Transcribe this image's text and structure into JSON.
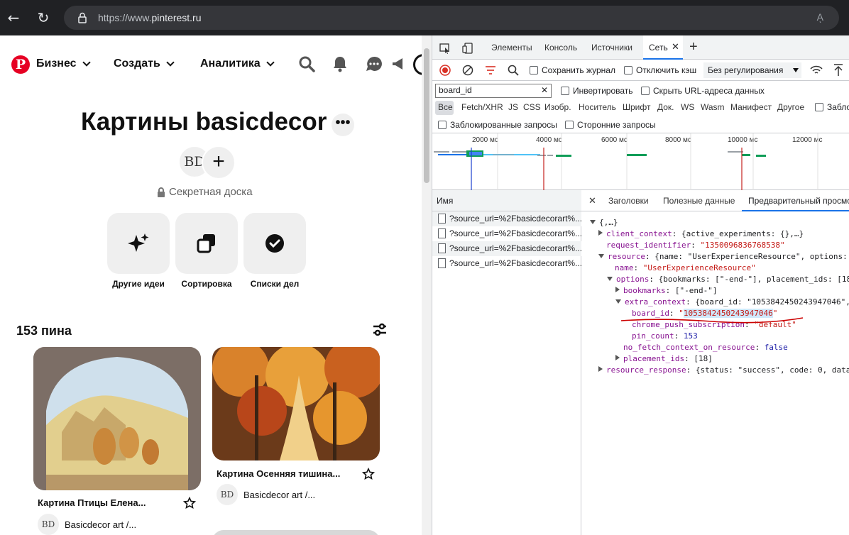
{
  "browser": {
    "url_prefix": "https://www.",
    "url_domain": "pinterest.ru",
    "read_aloud": "Aͅ"
  },
  "pinterest": {
    "logo_letter": "P",
    "nav": {
      "business": "Бизнес",
      "create": "Создать",
      "analytics": "Аналитика"
    },
    "board_title": "Картины basicdecor",
    "more_label": "•••",
    "avatar_text": "BD",
    "secret": "Секретная доска",
    "tiles": [
      {
        "label": "Другие идеи",
        "icon": "sparkle-icon"
      },
      {
        "label": "Сортировка",
        "icon": "organize-icon"
      },
      {
        "label": "Списки дел",
        "icon": "checklist-icon"
      }
    ],
    "pin_count": "153 пина",
    "pins": [
      {
        "title": "Картина Птицы Елена...",
        "author": "Basicdecor art /..."
      },
      {
        "title": "Картина Осенняя тишина...",
        "author": "Basicdecor art /..."
      }
    ]
  },
  "devtools": {
    "tabs": [
      "Элементы",
      "Консоль",
      "Источники",
      "Сеть"
    ],
    "toolbar": {
      "preserve_log": "Сохранить журнал",
      "disable_cache": "Отключить кэш",
      "throttling": "Без регулирования"
    },
    "filter_value": "board_id",
    "invert": "Инвертировать",
    "hide_data_urls": "Скрыть URL-адреса данных",
    "types": [
      "Все",
      "Fetch/XHR",
      "JS",
      "CSS",
      "Изобр.",
      "Носитель",
      "Шрифт",
      "Док.",
      "WS",
      "Wasm",
      "Манифест",
      "Другое"
    ],
    "blocked_cookies": "Заблок",
    "blocked_requests": "Заблокированные запросы",
    "third_party": "Сторонние запросы",
    "timeline_ticks": [
      "2000 мс",
      "4000 мс",
      "6000 мс",
      "8000 мс",
      "10000 мс",
      "12000 мс"
    ],
    "name_header": "Имя",
    "requests": [
      "?source_url=%2Fbasicdecorart%...",
      "?source_url=%2Fbasicdecorart%...",
      "?source_url=%2Fbasicdecorart%...",
      "?source_url=%2Fbasicdecorart%..."
    ],
    "detail_tabs": [
      "Заголовки",
      "Полезные данные",
      "Предварительный просмо"
    ],
    "preview": {
      "root": "{,…}",
      "client_context_key": "client_context",
      "client_context_val": "{active_experiments: {},…}",
      "request_identifier_key": "request_identifier",
      "request_identifier_val": "\"1350096836768538\"",
      "resource_key": "resource",
      "resource_val": "{name: \"UserExperienceResource\", options:",
      "name_key": "name",
      "name_val": "\"UserExperienceResource\"",
      "options_key": "options",
      "options_val": "{bookmarks: [\"-end-\"], placement_ids: [18",
      "bookmarks_key": "bookmarks",
      "bookmarks_val": "[\"-end-\"]",
      "extra_context_key": "extra_context",
      "extra_context_val": "{board_id: \"1053842450243947046\",",
      "board_id_key": "board_id",
      "board_id_val": "1053842450243947046",
      "chrome_push_key": "chrome_push_subscription",
      "chrome_push_val": "\"default\"",
      "pin_count_key": "pin_count",
      "pin_count_val": "153",
      "no_fetch_key": "no_fetch_context_on_resource",
      "no_fetch_val": "false",
      "placement_ids_key": "placement_ids",
      "placement_ids_val": "[18]",
      "resource_response_key": "resource_response",
      "resource_response_val": "{status: \"success\", code: 0, data"
    }
  }
}
